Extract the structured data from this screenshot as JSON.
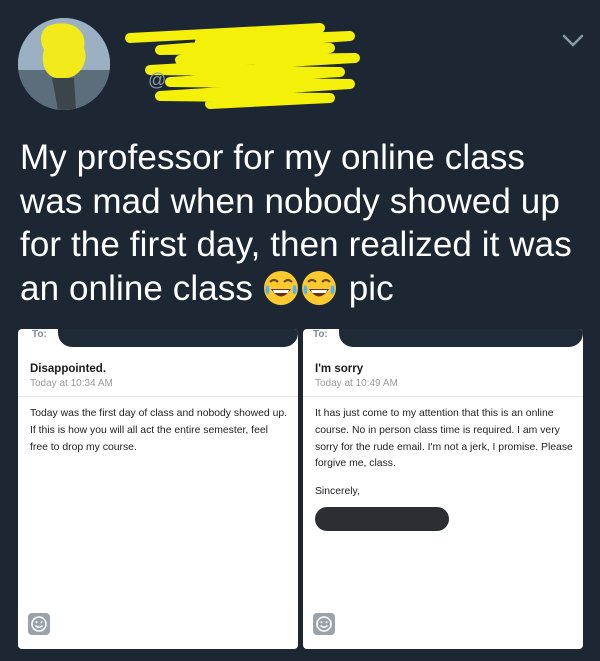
{
  "tweet": {
    "handle_prefix": "@",
    "text": "My professor for my online class was mad when nobody showed up for the first day, then realized it was an online class",
    "text_suffix": "pic",
    "emojis": [
      "face-with-tears-of-joy-icon",
      "face-with-tears-of-joy-icon"
    ]
  },
  "emails": [
    {
      "to_label": "To:",
      "subject": "Disappointed.",
      "time": "Today at 10:34 AM",
      "body": "Today was the first day of class and nobody showed up. If this is how you will all act the entire semester, feel free to drop my course.",
      "signoff": ""
    },
    {
      "to_label": "To:",
      "subject": "I'm sorry",
      "time": "Today at 10:49 AM",
      "body": "It has just come to my attention that this is an online course. No in person class time is required. I am very sorry for the rude email. I'm not a jerk, I promise. Please forgive me, class.",
      "signoff": "Sincerely,"
    }
  ],
  "colors": {
    "background": "#1c2733",
    "redaction_yellow": "#f4f00a",
    "text": "#ffffff"
  }
}
